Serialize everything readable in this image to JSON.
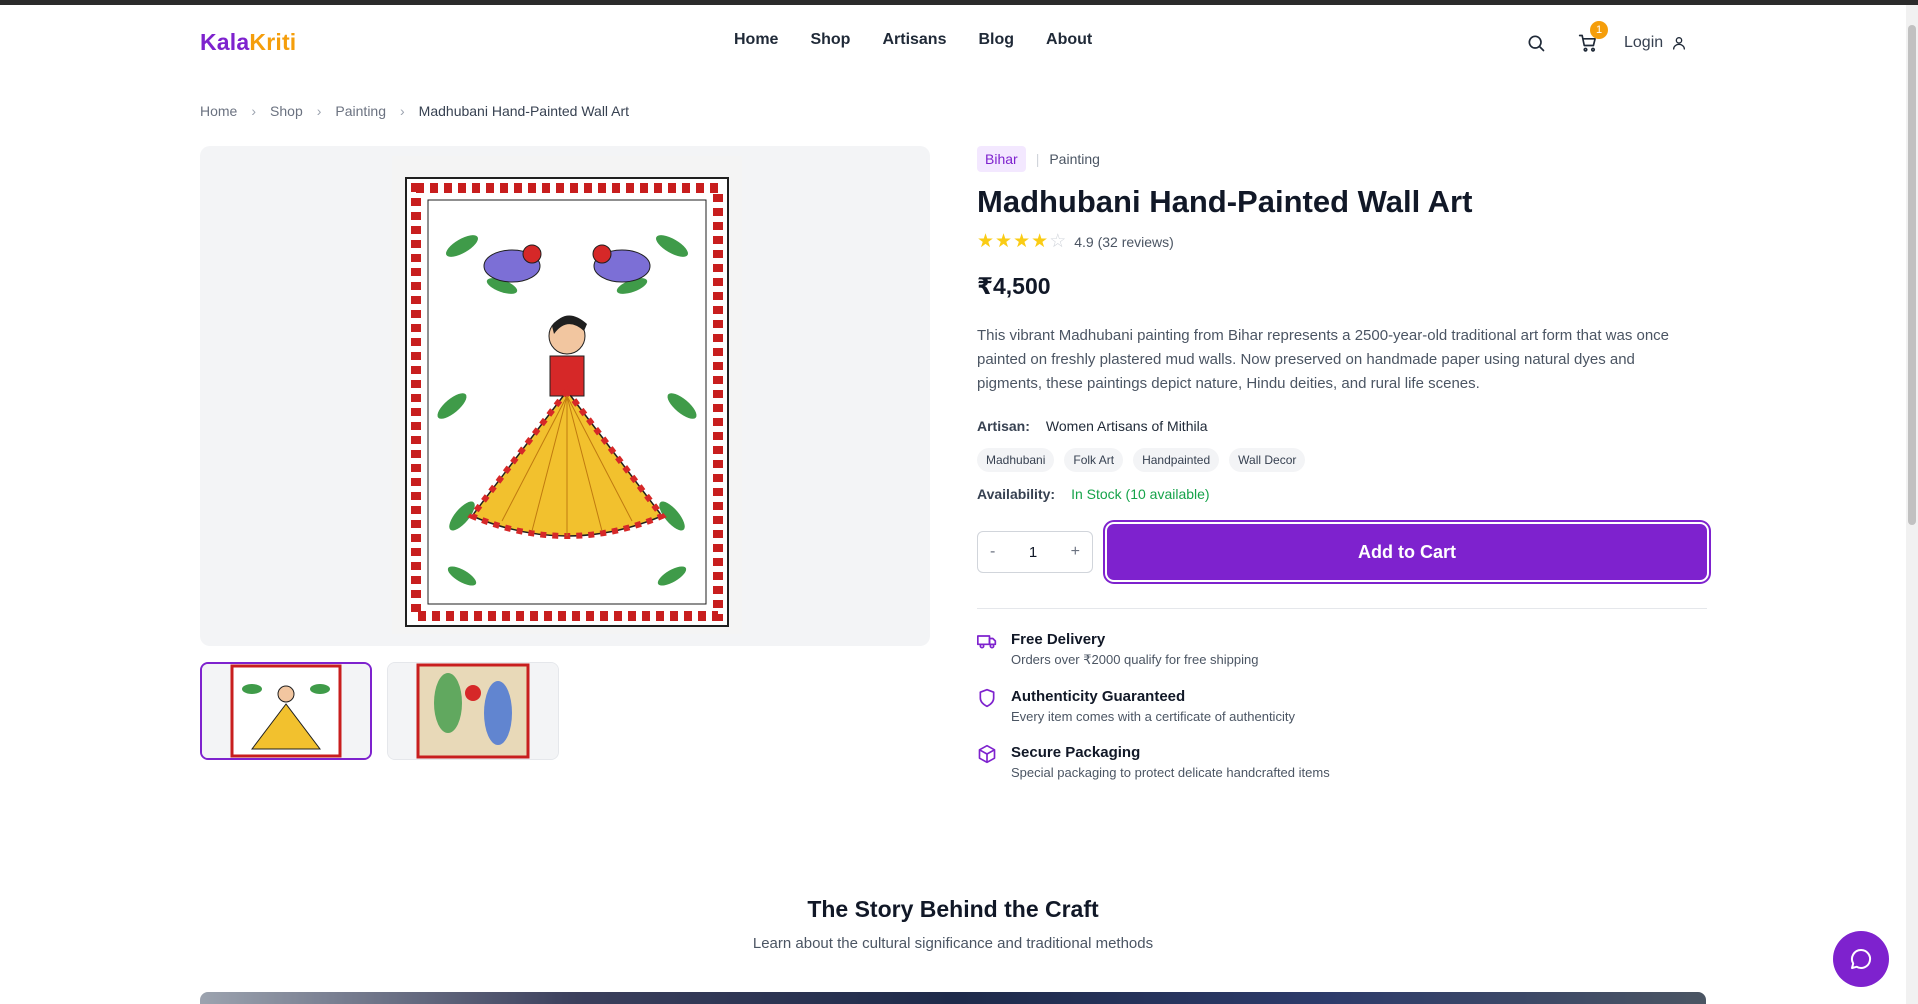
{
  "brand": {
    "part1": "Kala",
    "part2": "Kriti"
  },
  "nav": [
    "Home",
    "Shop",
    "Artisans",
    "Blog",
    "About"
  ],
  "header": {
    "cart_count": "1",
    "login_label": "Login"
  },
  "breadcrumb": [
    "Home",
    "Shop",
    "Painting",
    "Madhubani Hand-Painted Wall Art"
  ],
  "product": {
    "region": "Bihar",
    "category": "Painting",
    "title": "Madhubani Hand-Painted Wall Art",
    "rating_text": "4.9 (32 reviews)",
    "stars_filled": 4,
    "stars_total": 5,
    "price": "₹4,500",
    "description": "This vibrant Madhubani painting from Bihar represents a 2500-year-old traditional art form that was once painted on freshly plastered mud walls. Now preserved on handmade paper using natural dyes and pigments, these paintings depict nature, Hindu deities, and rural life scenes.",
    "artisan_label": "Artisan:",
    "artisan": "Women Artisans of Mithila",
    "tags": [
      "Madhubani",
      "Folk Art",
      "Handpainted",
      "Wall Decor"
    ],
    "availability_label": "Availability:",
    "availability": "In Stock (10 available)",
    "quantity": "1",
    "qty_minus": "-",
    "qty_plus": "+",
    "add_to_cart": "Add to Cart"
  },
  "features": [
    {
      "icon": "truck-icon",
      "title": "Free Delivery",
      "desc": "Orders over ₹2000 qualify for free shipping"
    },
    {
      "icon": "shield-icon",
      "title": "Authenticity Guaranteed",
      "desc": "Every item comes with a certificate of authenticity"
    },
    {
      "icon": "box-icon",
      "title": "Secure Packaging",
      "desc": "Special packaging to protect delicate handcrafted items"
    }
  ],
  "story": {
    "title": "The Story Behind the Craft",
    "subtitle": "Learn about the cultural significance and traditional methods"
  },
  "colors": {
    "accent": "#7e22ce",
    "secondary": "#f59e0b",
    "success": "#16a34a"
  }
}
